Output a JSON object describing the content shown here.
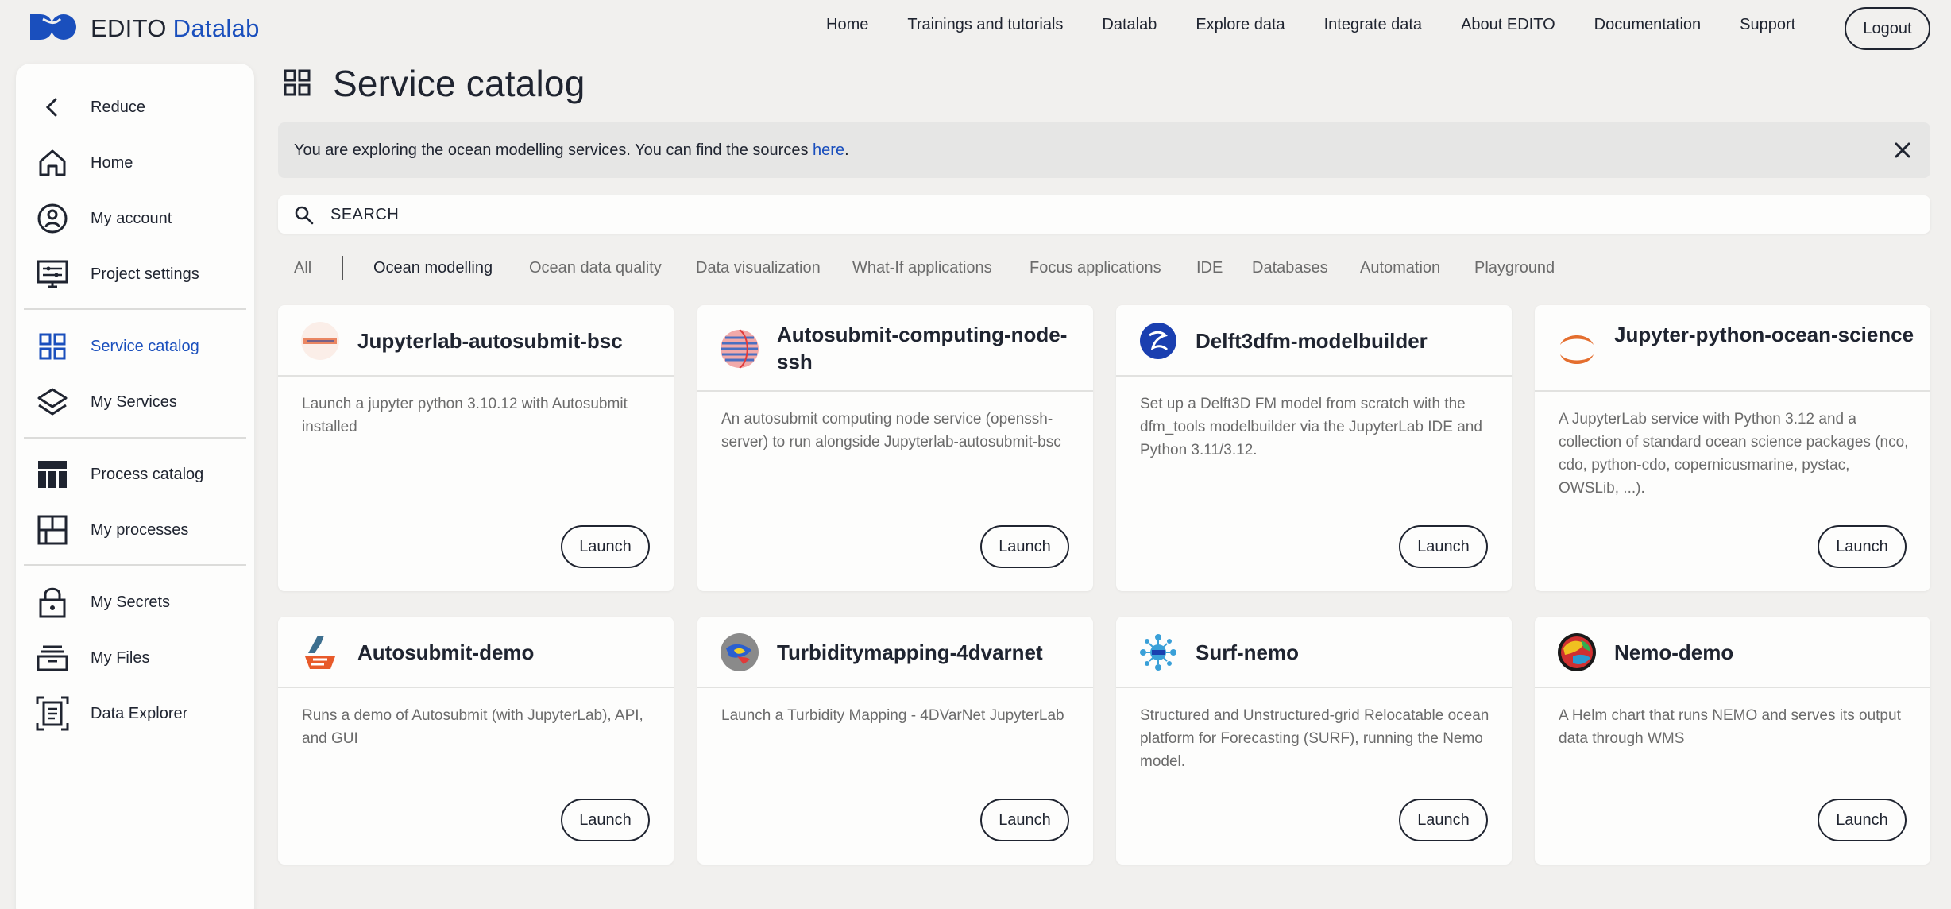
{
  "brand": {
    "name": "EDITO",
    "product": "Datalab"
  },
  "topnav": [
    "Home",
    "Trainings and tutorials",
    "Datalab",
    "Explore data",
    "Integrate data",
    "About EDITO",
    "Documentation",
    "Support"
  ],
  "logout_label": "Logout",
  "sidebar": {
    "items": [
      {
        "label": "Reduce",
        "icon": "chevron-left-icon"
      },
      {
        "label": "Home",
        "icon": "home-icon"
      },
      {
        "label": "My account",
        "icon": "account-icon"
      },
      {
        "label": "Project settings",
        "icon": "settings-monitor-icon"
      },
      {
        "label": "Service catalog",
        "icon": "grid-icon",
        "active": true
      },
      {
        "label": "My Services",
        "icon": "layers-icon"
      },
      {
        "label": "Process catalog",
        "icon": "table-icon"
      },
      {
        "label": "My processes",
        "icon": "dashboard-icon"
      },
      {
        "label": "My Secrets",
        "icon": "lock-icon"
      },
      {
        "label": "My Files",
        "icon": "files-icon"
      },
      {
        "label": "Data Explorer",
        "icon": "document-scan-icon"
      }
    ]
  },
  "page": {
    "title": "Service catalog"
  },
  "banner": {
    "text": "You are exploring the ocean modelling services. You can find the sources ",
    "link": "here",
    "suffix": "."
  },
  "search": {
    "placeholder": "SEARCH"
  },
  "filters": [
    "All",
    "Ocean modelling",
    "Ocean data quality",
    "Data visualization",
    "What-If applications",
    "Focus applications",
    "IDE",
    "Databases",
    "Automation",
    "Playground"
  ],
  "active_filter": "Ocean modelling",
  "colors": {
    "accent": "#1a4fbd",
    "text": "#1f2430",
    "muted": "#6b6b6b",
    "background": "#f1f0ee"
  },
  "cards": [
    {
      "title": "Jupyterlab-autosubmit-bsc",
      "description": "Launch a jupyter python 3.10.12 with Autosubmit installed",
      "launch": "Launch",
      "icon": "autosubmit-bsc-logo-icon"
    },
    {
      "title": "Autosubmit-computing-node-ssh",
      "description": "An autosubmit computing node service (openssh-server) to run alongside Jupyterlab-autosubmit-bsc",
      "launch": "Launch",
      "icon": "sphere-icon"
    },
    {
      "title": "Delft3dfm-modelbuilder",
      "description": "Set up a Delft3D FM model from scratch with the dfm_tools modelbuilder via the JupyterLab IDE and Python 3.11/3.12.",
      "launch": "Launch",
      "icon": "deltares-logo-icon"
    },
    {
      "title": "Jupyter-python-ocean-science",
      "description": "A JupyterLab service with Python 3.12 and a collection of standard ocean science packages (nco, cdo, python-cdo, copernicusmarine, pystac, OWSLib, ...).",
      "launch": "Launch",
      "icon": "jupyter-logo-icon"
    },
    {
      "title": "Autosubmit-demo",
      "description": "Runs a demo of Autosubmit (with JupyterLab), API, and GUI",
      "launch": "Launch",
      "icon": "autosubmit-logo-icon"
    },
    {
      "title": "Turbiditymapping-4dvarnet",
      "description": "Launch a Turbidity Mapping - 4DVarNet JupyterLab",
      "launch": "Launch",
      "icon": "turbidity-map-icon"
    },
    {
      "title": "Surf-nemo",
      "description": "Structured and Unstructured-grid Relocatable ocean platform for Forecasting (SURF), running the Nemo model.",
      "launch": "Launch",
      "icon": "surf-logo-icon"
    },
    {
      "title": "Nemo-demo",
      "description": "A Helm chart that runs NEMO and serves its output data through WMS",
      "launch": "Launch",
      "icon": "globe-icon"
    }
  ]
}
